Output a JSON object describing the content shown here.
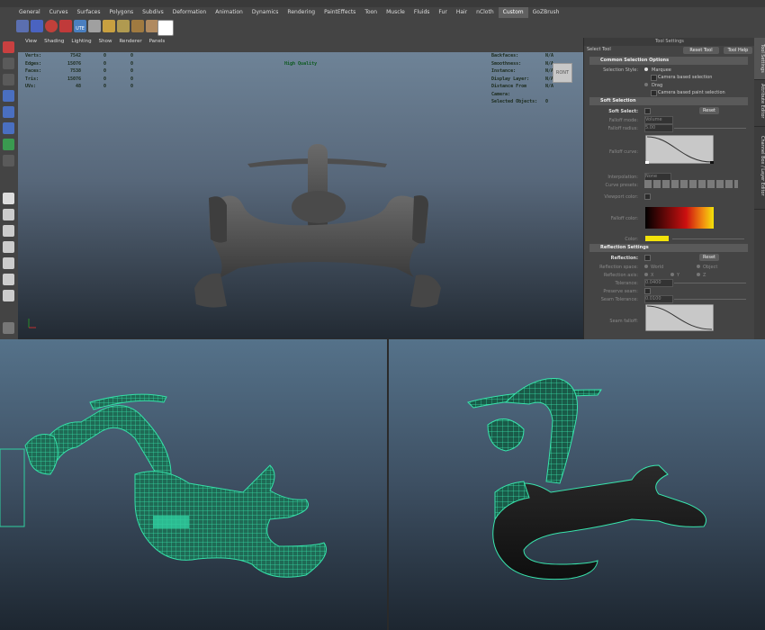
{
  "shelf": {
    "tabs": [
      "General",
      "Curves",
      "Surfaces",
      "Polygons",
      "Subdivs",
      "Deformation",
      "Animation",
      "Dynamics",
      "Rendering",
      "PaintEffects",
      "Toon",
      "Muscle",
      "Fluids",
      "Fur",
      "Hair",
      "nCloth",
      "Custom",
      "GoZBrush"
    ],
    "active_tab": "Custom",
    "icons": [
      "shelf-icon-1",
      "shelf-icon-2",
      "shelf-icon-3",
      "shelf-icon-4",
      "ute-label",
      "shelf-icon-6",
      "shelf-icon-7",
      "shelf-icon-8",
      "shelf-icon-9",
      "shelf-icon-10",
      "shelf-icon-11"
    ],
    "ute_label": "UTE"
  },
  "viewport": {
    "menu": [
      "View",
      "Shading",
      "Lighting",
      "Show",
      "Renderer",
      "Panels"
    ],
    "hud_left": [
      {
        "label": "Verts:",
        "a": "7542",
        "b": "0",
        "c": "0"
      },
      {
        "label": "Edges:",
        "a": "15076",
        "b": "0",
        "c": "0"
      },
      {
        "label": "Faces:",
        "a": "7538",
        "b": "0",
        "c": "0"
      },
      {
        "label": "Tris:",
        "a": "15076",
        "b": "0",
        "c": "0"
      },
      {
        "label": "UVs:",
        "a": "48",
        "b": "0",
        "c": "0"
      }
    ],
    "hud_center": "High Quality",
    "hud_right": [
      {
        "label": "Backfaces:",
        "value": "N/A"
      },
      {
        "label": "Smoothness:",
        "value": "N/A"
      },
      {
        "label": "Instance:",
        "value": "N/A"
      },
      {
        "label": "Display Layer:",
        "value": "N/A"
      },
      {
        "label": "Distance From Camera:",
        "value": "N/A"
      },
      {
        "label": "Selected Objects:",
        "value": "0"
      }
    ],
    "view_cube_label": "RONT"
  },
  "tool_settings": {
    "title": "Tool Settings",
    "tool_name": "Select Tool",
    "reset_tool": "Reset Tool",
    "tool_help": "Tool Help",
    "common_section": "Common Selection Options",
    "selection_style_label": "Selection Style:",
    "marquee": "Marquee",
    "camera_based_selection": "Camera based selection",
    "drag": "Drag",
    "camera_based_paint": "Camera based paint selection",
    "soft_section": "Soft Selection",
    "soft_select_label": "Soft Select:",
    "reset": "Reset",
    "falloff_mode_label": "Falloff mode:",
    "falloff_mode_value": "Volume",
    "falloff_radius_label": "Falloff radius:",
    "falloff_radius_value": "5.00",
    "falloff_curve_label": "Falloff curve:",
    "interpolation_label": "Interpolation:",
    "interpolation_value": "None",
    "curve_presets_label": "Curve presets:",
    "viewport_color_label": "Viewport color:",
    "falloff_color_label": "Falloff color:",
    "color_label": "Color:",
    "reflection_section": "Reflection Settings",
    "reflection_label": "Reflection:",
    "reflection_space_label": "Reflection space:",
    "world": "World",
    "object": "Object",
    "reflection_axis_label": "Reflection axis:",
    "axis_x": "X",
    "axis_y": "Y",
    "axis_z": "Z",
    "tolerance_label": "Tolerance:",
    "tolerance_value": "0.0400",
    "preserve_seam_label": "Preserve seam:",
    "seam_tolerance_label": "Seam Tolerance:",
    "seam_tolerance_value": "0.0100",
    "seam_falloff_label": "Seam falloff:",
    "colors": {
      "accent_yellow": "#f2e20a",
      "falloff_red": "#cc1010",
      "falloff_orange": "#f29010"
    }
  },
  "side_tabs": [
    "Tool Settings",
    "Attribute Editor",
    "Channel Box / Layer Editor"
  ]
}
